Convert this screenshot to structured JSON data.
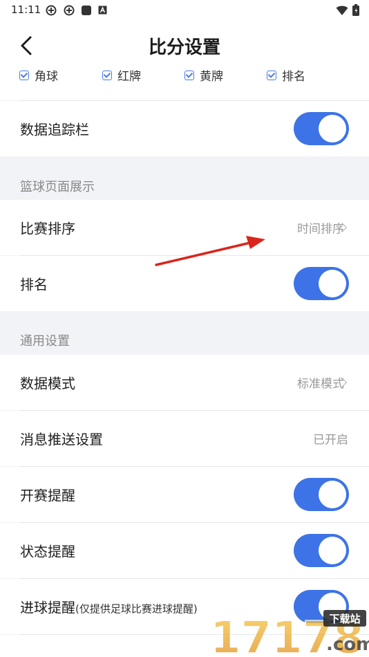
{
  "statusbar": {
    "time": "11:11",
    "icons": [
      "sync-icon",
      "sync-icon",
      "square-icon",
      "a-badge-icon"
    ],
    "right_icons": [
      "wifi-icon",
      "battery-icon"
    ]
  },
  "header": {
    "title": "比分设置",
    "back_icon": "chevron-left-icon",
    "checkboxes": [
      {
        "label": "角球",
        "checked": true
      },
      {
        "label": "红牌",
        "checked": true
      },
      {
        "label": "黄牌",
        "checked": true
      },
      {
        "label": "排名",
        "checked": true
      }
    ]
  },
  "football": {
    "data_tracker": {
      "label": "数据追踪栏",
      "on": true
    }
  },
  "basketball": {
    "section_title": "篮球页面展示",
    "match_sort": {
      "label": "比赛排序",
      "value": "时间排序"
    },
    "ranking": {
      "label": "排名",
      "on": true
    }
  },
  "general": {
    "section_title": "通用设置",
    "data_mode": {
      "label": "数据模式",
      "value": "标准模式"
    },
    "push": {
      "label": "消息推送设置",
      "value": "已开启"
    },
    "kickoff": {
      "label": "开赛提醒",
      "on": true
    },
    "status": {
      "label": "状态提醒",
      "on": true
    },
    "goal": {
      "label": "进球提醒",
      "note": "(仅提供足球比赛进球提醒)",
      "on": true
    }
  },
  "annotation": {
    "arrow_color": "#d9261c"
  },
  "watermark": {
    "digits": "17178",
    "badge": "下载站",
    "domain": ".com"
  },
  "colors": {
    "accent": "#3d73e6",
    "checkbox": "#4b7be5",
    "background": "#f2f3f7"
  }
}
